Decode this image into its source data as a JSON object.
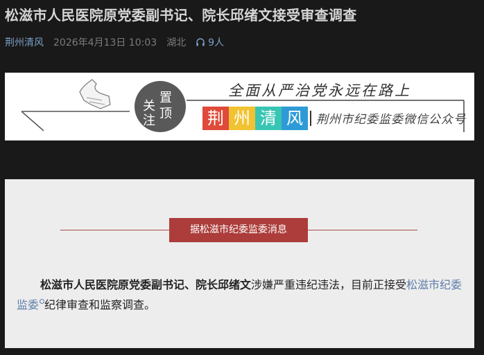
{
  "article": {
    "title": "松滋市人民医院原党委副书记、院长邱绪文接受审查调查",
    "account": "荆州清风",
    "date": "2026年4月13日 10:03",
    "region": "湖北",
    "listen_count": "9人"
  },
  "banner": {
    "pin_chars": [
      "关",
      "注",
      "置",
      "顶"
    ],
    "slogan": "全面从严治党永远在路上",
    "brand_chars": [
      "荆",
      "州",
      "清",
      "风"
    ],
    "brand_colors": [
      "#e04a3a",
      "#f1c232",
      "#39c5b4",
      "#2e9bd6"
    ],
    "subtitle": "荆州市纪委监委微信公众号"
  },
  "content": {
    "source_label": "据松滋市纪委监委消息",
    "paragraph": {
      "subject": "松滋市人民医院原党委副书记、院长邱绪文",
      "text_before_link": "涉嫌严重违纪违法，目前正接受",
      "link": "松滋市纪委监委",
      "text_after_link": "纪律审查和监察调查。"
    }
  },
  "colors": {
    "background": "#191919",
    "accent_link": "#7c9fc6",
    "label_red": "#ac3d3b"
  }
}
